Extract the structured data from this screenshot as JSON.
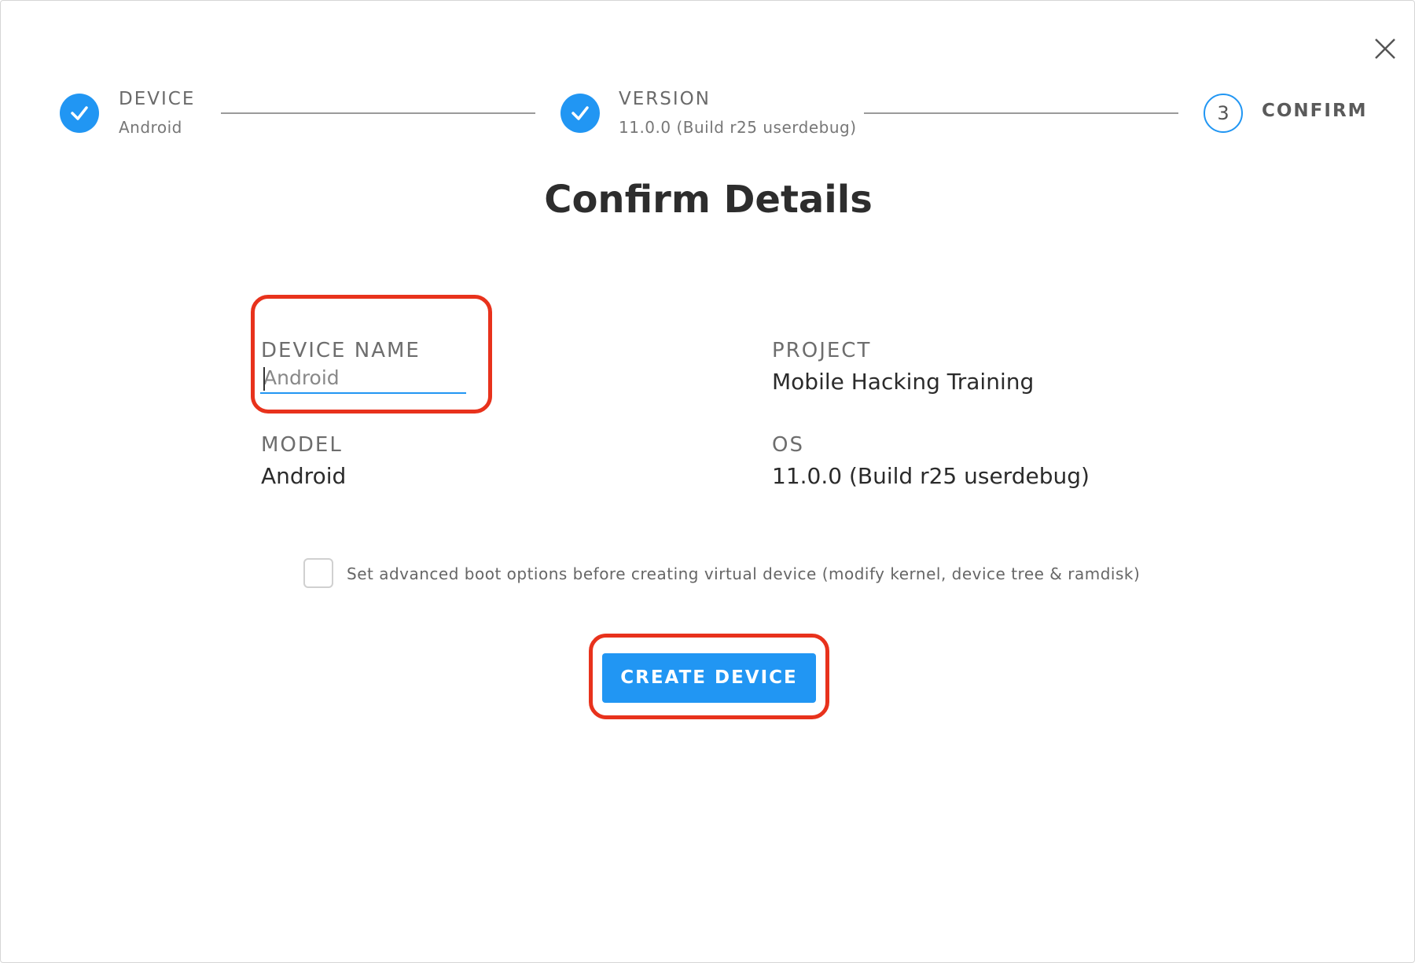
{
  "stepper": {
    "steps": [
      {
        "title": "DEVICE",
        "subtitle": "Android",
        "state": "done"
      },
      {
        "title": "VERSION",
        "subtitle": "11.0.0 (Build r25 userdebug)",
        "state": "done"
      },
      {
        "number": "3",
        "title": "CONFIRM",
        "state": "active"
      }
    ]
  },
  "page_title": "Confirm Details",
  "details": {
    "device_name_label": "DEVICE NAME",
    "device_name_value": "Android",
    "project_label": "PROJECT",
    "project_value": "Mobile Hacking Training",
    "model_label": "MODEL",
    "model_value": "Android",
    "os_label": "OS",
    "os_value": "11.0.0 (Build r25 userdebug)"
  },
  "advanced_boot": {
    "label": "Set advanced boot options before creating virtual device (modify kernel, device tree & ramdisk)",
    "checked": false
  },
  "create_button_label": "CREATE DEVICE",
  "icons": {
    "close": "close-icon",
    "step_done": "check-icon"
  },
  "colors": {
    "accent": "#2196f3",
    "annotation": "#e8321c"
  }
}
